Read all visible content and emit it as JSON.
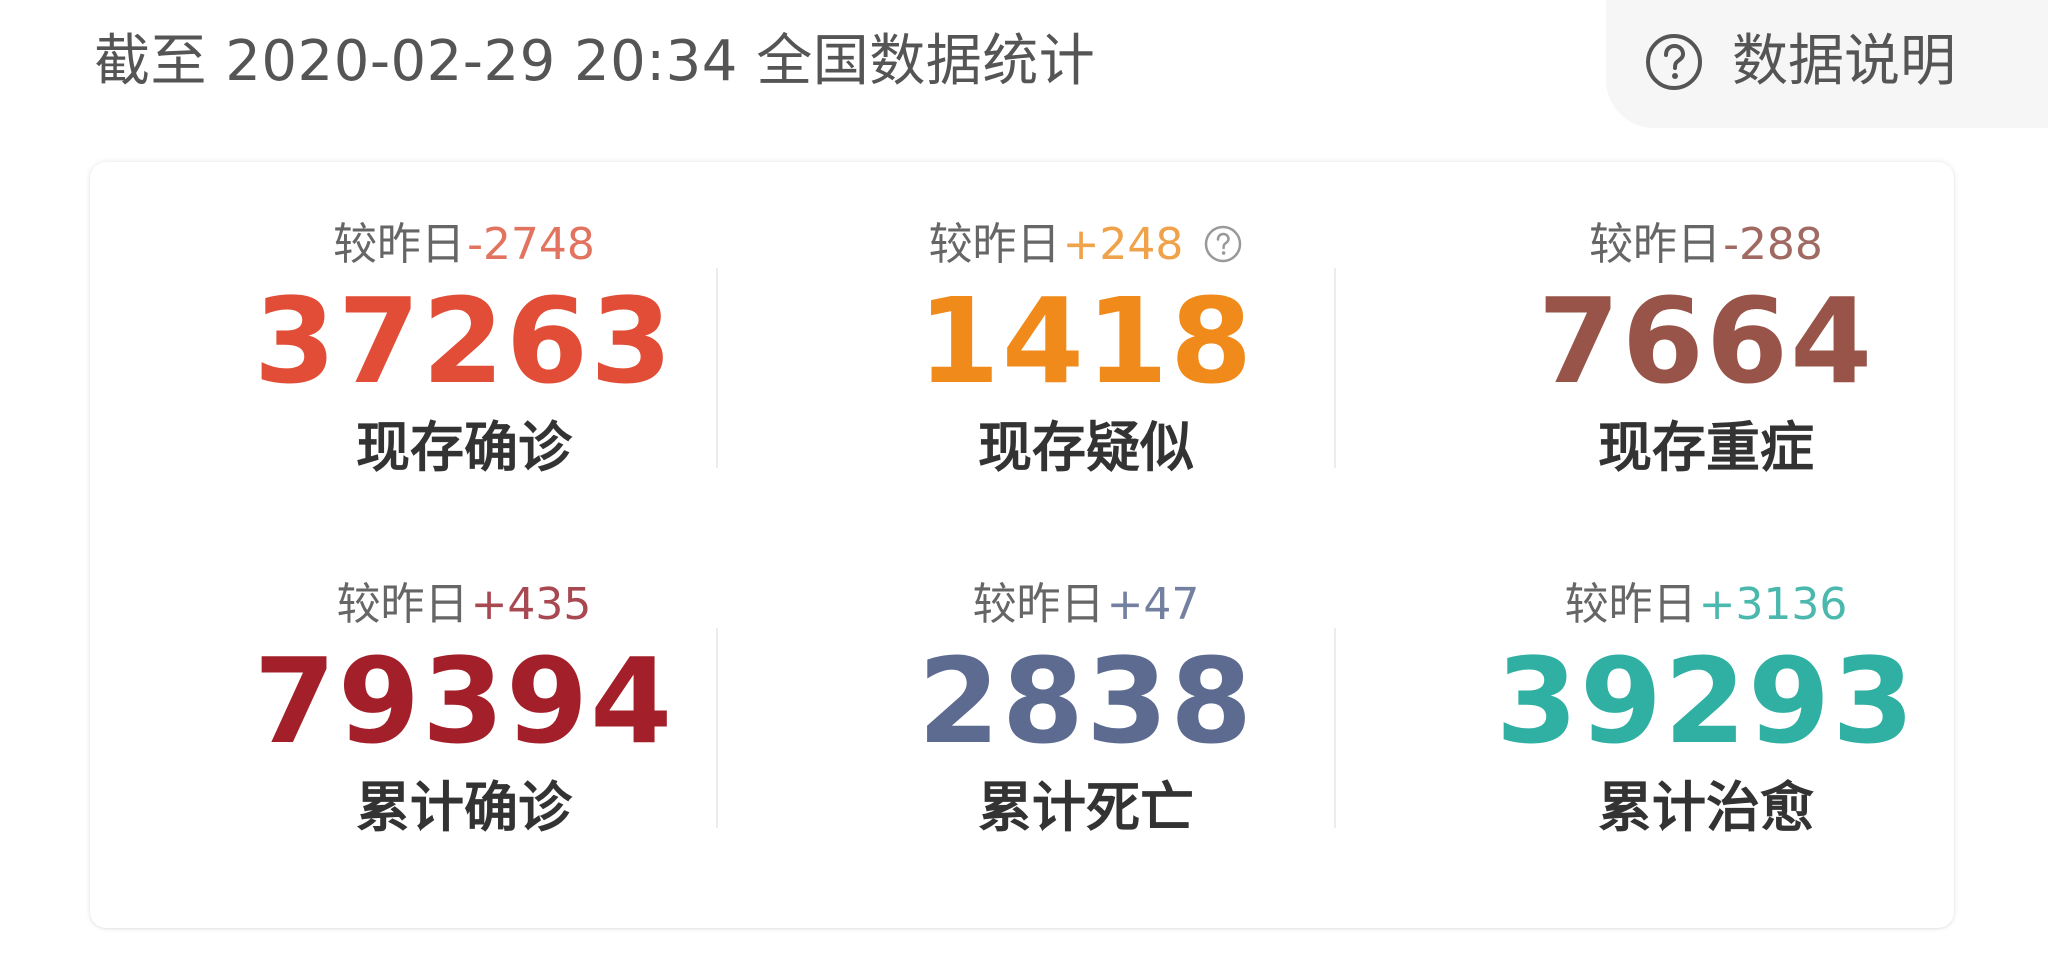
{
  "header": {
    "title": "截至 2020-02-29 20:34 全国数据统计",
    "help_label": "数据说明"
  },
  "stats": [
    {
      "compare_label": "较昨日",
      "delta": "-2748",
      "value": "37263",
      "label": "现存确诊",
      "color": "#e14d36",
      "delta_color": "#e1735f"
    },
    {
      "compare_label": "较昨日",
      "delta": "+248",
      "value": "1418",
      "label": "现存疑似",
      "color": "#f08a1a",
      "delta_color": "#f0a24a",
      "has_info": true
    },
    {
      "compare_label": "较昨日",
      "delta": "-288",
      "value": "7664",
      "label": "现存重症",
      "color": "#985449",
      "delta_color": "#a06a62"
    },
    {
      "compare_label": "较昨日",
      "delta": "+435",
      "value": "79394",
      "label": "累计确诊",
      "color": "#a3202b",
      "delta_color": "#a84851"
    },
    {
      "compare_label": "较昨日",
      "delta": "+47",
      "value": "2838",
      "label": "累计死亡",
      "color": "#5d6b91",
      "delta_color": "#7480a0"
    },
    {
      "compare_label": "较昨日",
      "delta": "+3136",
      "value": "39293",
      "label": "累计治愈",
      "color": "#2fb0a3",
      "delta_color": "#4ab8ad"
    }
  ]
}
